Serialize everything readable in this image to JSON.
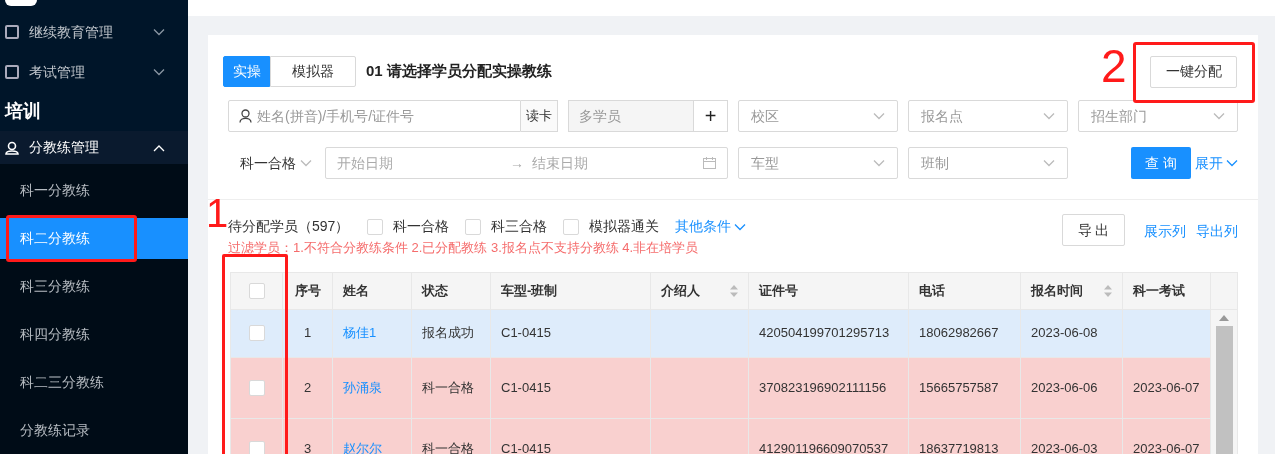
{
  "sidebar": {
    "menus": [
      {
        "label": "继续教育管理",
        "expanded": false
      },
      {
        "label": "考试管理",
        "expanded": false
      }
    ],
    "section": "培训",
    "group": {
      "label": "分教练管理",
      "expanded": true,
      "items": [
        {
          "label": "科一分教练",
          "selected": false,
          "annotated": false
        },
        {
          "label": "科二分教练",
          "selected": true,
          "annotated": true
        },
        {
          "label": "科三分教练",
          "selected": false,
          "annotated": false
        },
        {
          "label": "科四分教练",
          "selected": false,
          "annotated": false
        },
        {
          "label": "科二三分教练",
          "selected": false,
          "annotated": false
        },
        {
          "label": "分教练记录",
          "selected": false,
          "annotated": false
        }
      ]
    }
  },
  "tabs": [
    {
      "label": "实操",
      "selected": true
    },
    {
      "label": "模拟器",
      "selected": false
    }
  ],
  "title": "01 请选择学员分配实操教练",
  "assign_button": "一键分配",
  "filters": {
    "name": {
      "placeholder": "姓名(拼音)/手机号/证件号"
    },
    "read_card": "读卡",
    "multi": {
      "placeholder": "多学员"
    },
    "add": "+",
    "campus": {
      "placeholder": "校区"
    },
    "signup_point": {
      "placeholder": "报名点"
    },
    "department": {
      "placeholder": "招生部门"
    },
    "subject": "科一合格",
    "start": {
      "placeholder": "开始日期"
    },
    "range_sep": "→",
    "end": {
      "placeholder": "结束日期"
    },
    "car_type": {
      "placeholder": "车型"
    },
    "class": {
      "placeholder": "班制"
    },
    "query": "查 询",
    "expand": "展开"
  },
  "summary": "待分配学员（597）",
  "quick_filters": [
    {
      "label": "科一合格",
      "checked": false
    },
    {
      "label": "科三合格",
      "checked": false
    },
    {
      "label": "模拟器通关",
      "checked": false
    }
  ],
  "other_conditions": "其他条件",
  "filter_note": "过滤学员：1.不符合分教练条件 2.已分配教练 3.报名点不支持分教练 4.非在培学员",
  "export_button": "导 出",
  "show_columns": "展示列",
  "export_columns": "导出列",
  "table": {
    "select_all": false,
    "columns": [
      {
        "label": "序号",
        "sortable": false
      },
      {
        "label": "姓名",
        "sortable": false
      },
      {
        "label": "状态",
        "sortable": false
      },
      {
        "label": "车型-班制",
        "sortable": false
      },
      {
        "label": "介绍人",
        "sortable": true
      },
      {
        "label": "证件号",
        "sortable": false
      },
      {
        "label": "电话",
        "sortable": false
      },
      {
        "label": "报名时间",
        "sortable": true
      },
      {
        "label": "科一考试",
        "sortable": false
      }
    ],
    "rows": [
      {
        "selected": false,
        "color": "#deecfb",
        "cells": [
          "1",
          "杨佳1",
          "报名成功",
          "C1-0415",
          "",
          "420504199701295713",
          "18062982667",
          "2023-06-08",
          ""
        ]
      },
      {
        "selected": false,
        "color": "#f9d0cf",
        "cells": [
          "2",
          "孙涌泉",
          "科一合格",
          "C1-0415",
          "",
          "370823196902111156",
          "15665757587",
          "2023-06-06",
          "2023-06-07"
        ]
      },
      {
        "selected": false,
        "color": "#f9d0cf",
        "cells": [
          "3",
          "赵尔尔",
          "科一合格",
          "C1-0415",
          "",
          "412901196609070537",
          "18637719813",
          "2023-06-03",
          "2023-06-07"
        ]
      }
    ]
  },
  "annotations": [
    {
      "label": "1"
    },
    {
      "label": "2"
    }
  ]
}
